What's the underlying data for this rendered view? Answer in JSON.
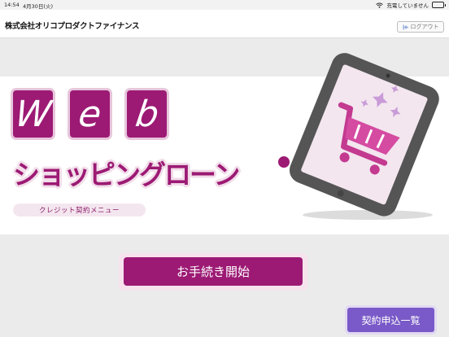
{
  "status_bar": {
    "time": "14:54",
    "date": "4月30日(火)",
    "charging": "充電していません"
  },
  "header": {
    "company": "株式会社オリコプロダクトファイナンス",
    "logout_label": "ログアウト"
  },
  "hero": {
    "web_letters": [
      "W",
      "e",
      "b"
    ],
    "title": "ショッピングローン",
    "subtitle": "クレジット契約メニュー"
  },
  "actions": {
    "start_label": "お手続き開始",
    "list_label": "契約申込一覧"
  },
  "colors": {
    "brand": "#9c1a74",
    "brand_light": "#f4e6ef",
    "secondary": "#7a5ac8"
  },
  "icons": [
    "wifi-icon",
    "battery-icon",
    "logout-icon",
    "tablet-cart-illustration",
    "globe-icon"
  ]
}
